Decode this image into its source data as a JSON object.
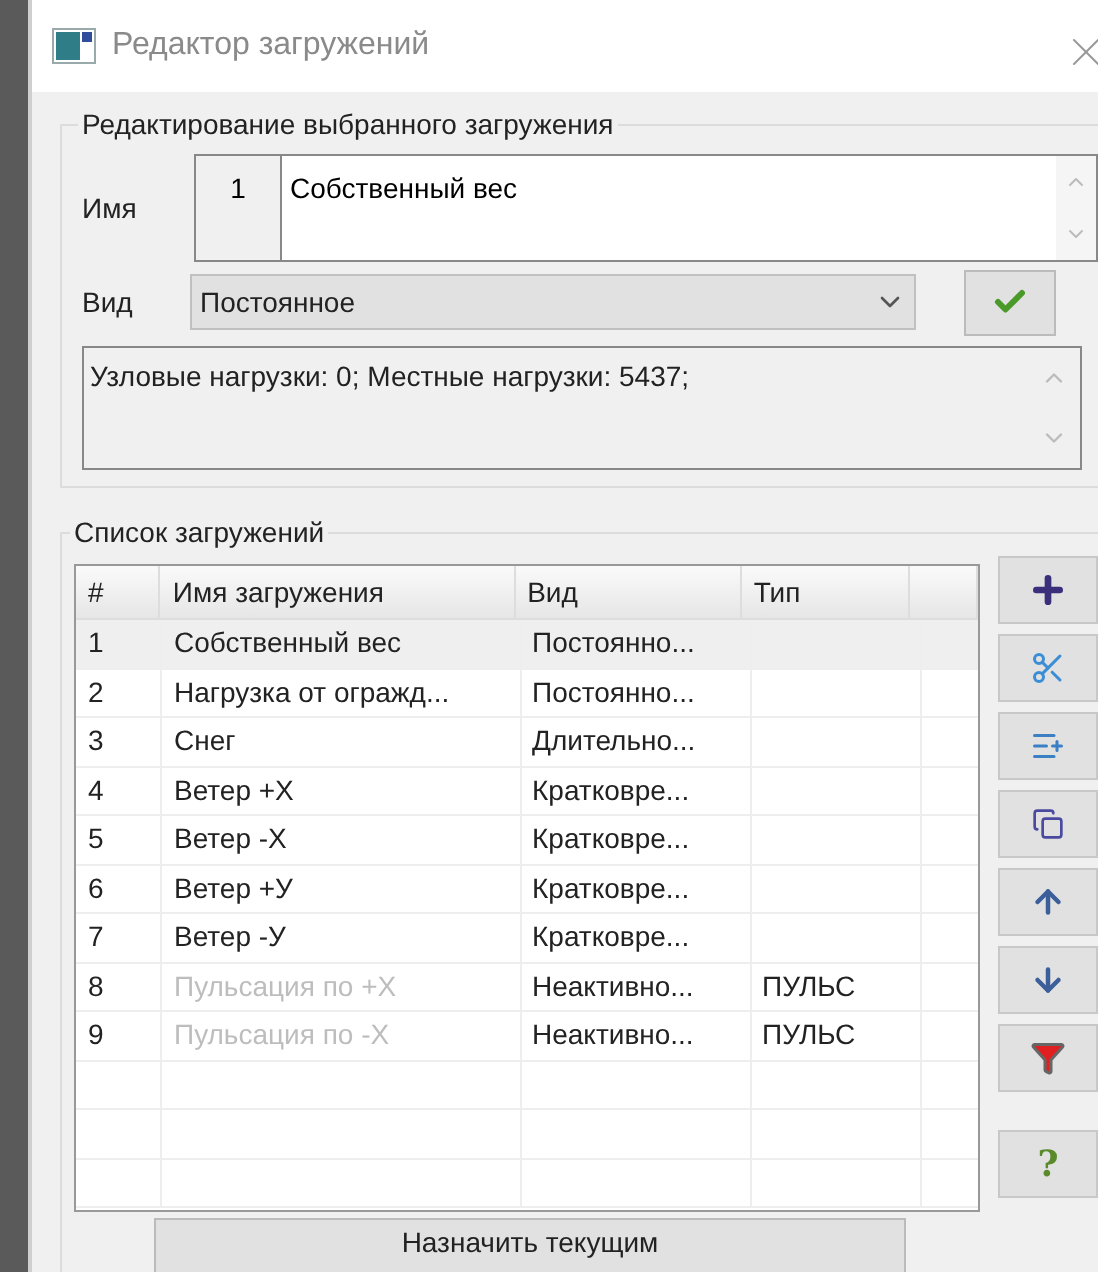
{
  "window": {
    "title": "Редактор загружений"
  },
  "edit_group": {
    "title": "Редактирование выбранного загружения",
    "name_label": "Имя",
    "number": "1",
    "name_value": "Собственный вес",
    "kind_label": "Вид",
    "kind_value": "Постоянное",
    "info": "Узловые нагрузки:  0;  Местные нагрузки:  5437;"
  },
  "list_group": {
    "title": "Список загружений"
  },
  "table": {
    "columns": [
      "#",
      "Имя загружения",
      "Вид",
      "Тип"
    ],
    "rows": [
      {
        "num": "1",
        "name": "Собственный вес",
        "kind": "Постоянно...",
        "type": "",
        "selected": true,
        "inactive": false
      },
      {
        "num": "2",
        "name": "Нагрузка от огражд...",
        "kind": "Постоянно...",
        "type": "",
        "selected": false,
        "inactive": false
      },
      {
        "num": "3",
        "name": "Снег",
        "kind": "Длительно...",
        "type": "",
        "selected": false,
        "inactive": false
      },
      {
        "num": "4",
        "name": "Ветер +Х",
        "kind": "Кратковре...",
        "type": "",
        "selected": false,
        "inactive": false
      },
      {
        "num": "5",
        "name": "Ветер -Х",
        "kind": "Кратковре...",
        "type": "",
        "selected": false,
        "inactive": false
      },
      {
        "num": "6",
        "name": "Ветер +У",
        "kind": "Кратковре...",
        "type": "",
        "selected": false,
        "inactive": false
      },
      {
        "num": "7",
        "name": "Ветер -У",
        "kind": "Кратковре...",
        "type": "",
        "selected": false,
        "inactive": false
      },
      {
        "num": "8",
        "name": "Пульсация по +Х",
        "kind": "Неактивно...",
        "type": "ПУЛЬС",
        "selected": false,
        "inactive": true
      },
      {
        "num": "9",
        "name": "Пульсация по -Х",
        "kind": "Неактивно...",
        "type": "ПУЛЬС",
        "selected": false,
        "inactive": true
      }
    ]
  },
  "tools": [
    {
      "kind": "add"
    },
    {
      "kind": "cut"
    },
    {
      "kind": "insert"
    },
    {
      "kind": "copy"
    },
    {
      "kind": "up"
    },
    {
      "kind": "down"
    },
    {
      "kind": "filter"
    },
    {
      "kind": "help",
      "label": "?"
    }
  ],
  "assign_button": "Назначить текущим"
}
